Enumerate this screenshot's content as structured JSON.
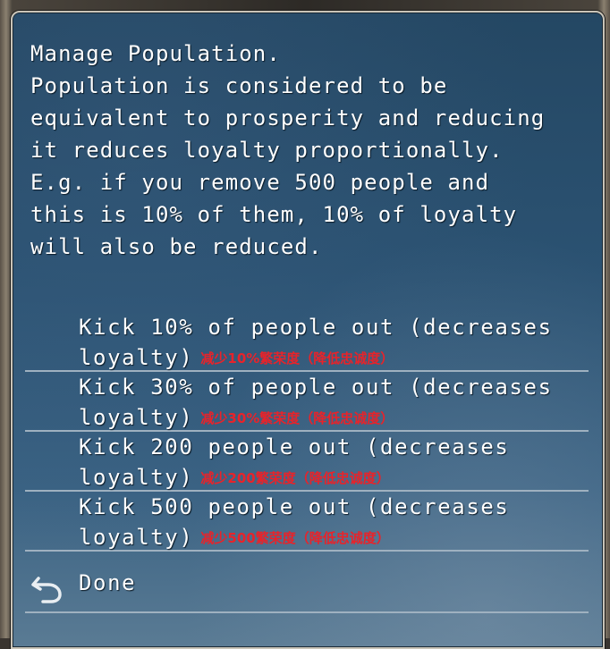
{
  "dialog": {
    "description_lines": [
      "Manage Population.",
      "Population is considered to be",
      "equivalent to prosperity and reducing",
      "it reduces loyalty proportionally.",
      "E.g. if you remove 500 people and",
      "this is 10% of them, 10% of loyalty",
      "will also be reduced."
    ],
    "options": [
      {
        "line1": "Kick 10% of people out (decreases",
        "line2": "loyalty)",
        "cn": "减少10%繁荣度（降低忠诚度）"
      },
      {
        "line1": "Kick 30% of people out (decreases",
        "line2": "loyalty)",
        "cn": "减少30%繁荣度（降低忠诚度）"
      },
      {
        "line1": "Kick 200 people out (decreases",
        "line2": "loyalty)",
        "cn": "减少200繁荣度（降低忠诚度）"
      },
      {
        "line1": "Kick 500 people out (decreases",
        "line2": "loyalty)",
        "cn": "减少500繁荣度（降低忠诚度）"
      }
    ],
    "done_label": "Done",
    "done_icon": "undo-arrow-icon"
  },
  "colors": {
    "text": "#ffffff",
    "translation": "#e8232a",
    "divider": "#9fb1c0",
    "panel_top": "#244763",
    "panel_bottom": "#5a7b94"
  }
}
